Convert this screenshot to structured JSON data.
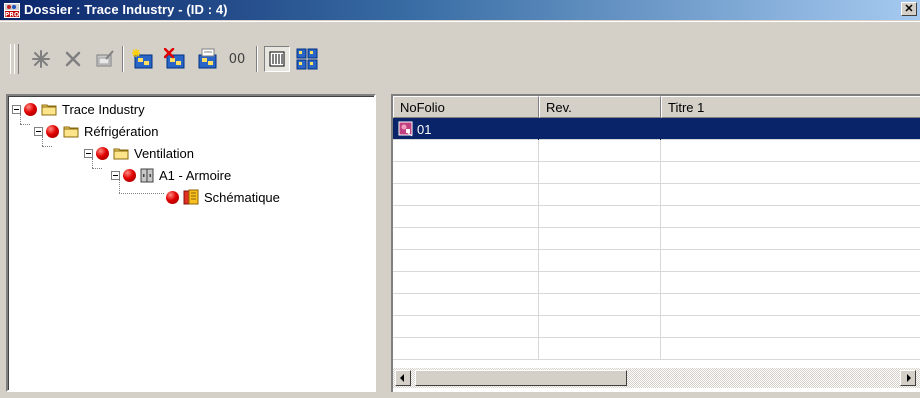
{
  "window": {
    "title": "Dossier : Trace Industry - (ID : 4)",
    "close_glyph": "✕",
    "app_icon": "pro-app-icon"
  },
  "toolbar": {
    "buttons": [
      {
        "name": "new-icon"
      },
      {
        "name": "delete-icon"
      },
      {
        "name": "properties-icon"
      },
      {
        "name": "add-folder-icon"
      },
      {
        "name": "remove-folder-icon"
      },
      {
        "name": "edit-folder-icon"
      },
      {
        "name": "infinity-icon",
        "label": "00"
      },
      {
        "name": "list-view-icon",
        "pressed": true
      },
      {
        "name": "grid-view-icon"
      }
    ]
  },
  "tree": {
    "items": [
      {
        "label": "Trace Industry",
        "icon": "folder-icon",
        "level": 0
      },
      {
        "label": "Réfrigération",
        "icon": "folder-icon",
        "level": 1
      },
      {
        "label": "Ventilation",
        "icon": "folder-icon",
        "level": 2
      },
      {
        "label": "A1 - Armoire",
        "icon": "cabinet-icon",
        "level": 3
      },
      {
        "label": "Schématique",
        "icon": "schematic-book-icon",
        "level": 4
      }
    ]
  },
  "list": {
    "columns": [
      "NoFolio",
      "Rev.",
      "Titre 1"
    ],
    "rows": [
      {
        "nofolio": "01",
        "rev": "",
        "titre1": "",
        "selected": true
      }
    ]
  },
  "colors": {
    "selection": "#0a246a",
    "status_ball": "#e00000",
    "folder": "#f8d868",
    "window_bg": "#d4d0c8"
  }
}
